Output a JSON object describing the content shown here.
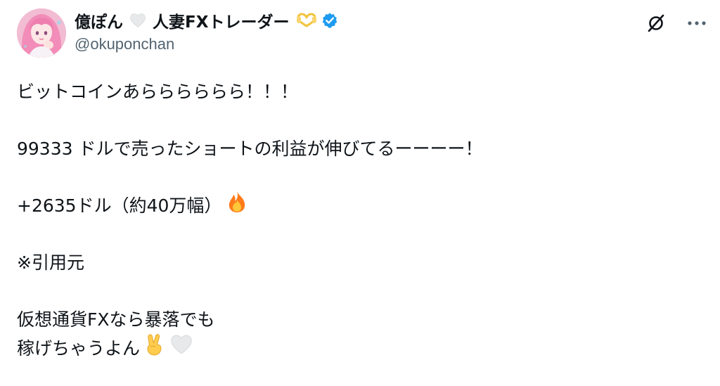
{
  "post": {
    "author": {
      "name_part1": "億ぽん",
      "name_part2": "人妻FXトレーダー",
      "handle": "@okuponchan",
      "verified": true,
      "name_emoji_1": "white-heart-icon",
      "name_emoji_2": "heart-hands-icon"
    },
    "lines": {
      "l1": "ビットコインあらららららら！！！",
      "l2": "99333 ドルで売ったショートの利益が伸びてるーーーー！",
      "l3": "+2635ドル（約40万幅）",
      "l4": "※引用元",
      "l5": "仮想通貨FXなら暴落でも",
      "l6": "稼げちゃうよん"
    },
    "icons": {
      "fire": "fire-icon",
      "victory": "victory-hand-icon",
      "heart": "white-heart-icon",
      "grok": "grok-icon",
      "more": "more-icon"
    },
    "colors": {
      "text": "#0f1419",
      "secondary": "#536471",
      "verified": "#1d9bf0",
      "heart": "#e7e9ea",
      "heart_hands": "#f9d56e",
      "fire": "#ff7a1a"
    }
  }
}
